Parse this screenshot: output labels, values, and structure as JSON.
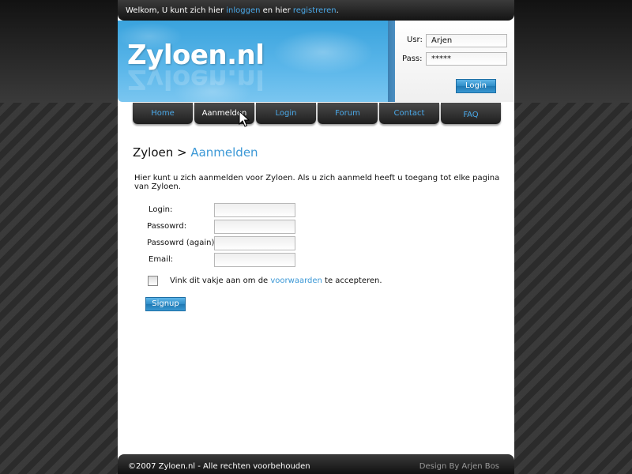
{
  "welcome": {
    "prefix": "Welkom, U kunt zich hier ",
    "login_link": "inloggen",
    "middle": " en hier ",
    "register_link": "registreren",
    "suffix": "."
  },
  "banner": {
    "logo": "Zyloen.nl"
  },
  "login_box": {
    "user_label": "Usr:",
    "user_value": "Arjen",
    "pass_label": "Pass:",
    "pass_value": "*****",
    "button": "Login"
  },
  "nav": {
    "items": [
      "Home",
      "Aanmelden",
      "Login",
      "Forum",
      "Contact",
      "FAQ"
    ],
    "active": "Aanmelden"
  },
  "breadcrumb": {
    "root": "Zyloen",
    "separator": " > ",
    "current": "Aanmelden"
  },
  "intro": "Hier kunt u zich aanmelden voor Zyloen. Als u zich aanmeld heeft u toegang tot elke pagina van Zyloen.",
  "form": {
    "login_label": "Login:",
    "login_value": "",
    "password_label": "Passowrd:",
    "password_value": "",
    "password_again_label": "Passowrd (again):",
    "password_again_value": "",
    "email_label": "Email:",
    "email_value": "",
    "terms_checked": false,
    "terms_prefix": "Vink dit vakje aan om de ",
    "terms_link": "voorwaarden",
    "terms_suffix": " te accepteren.",
    "submit": "Signup"
  },
  "footer": {
    "copyright": "©2007 Zyloen.nl - Alle rechten voorbehouden",
    "credit": "Design By Arjen Bos"
  },
  "colors": {
    "accent": "#3b98d6",
    "link": "#4aa8e8",
    "dark_bar": "#1e1e1e",
    "banner_blue": "#4fb0e6"
  }
}
